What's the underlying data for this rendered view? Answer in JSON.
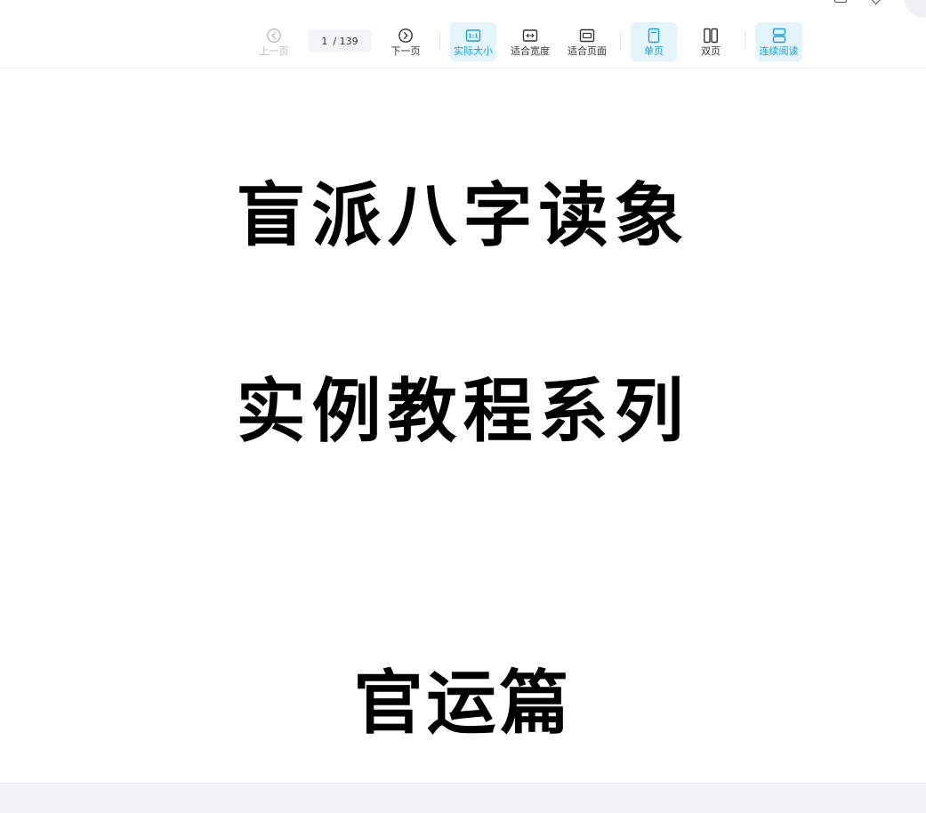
{
  "toolbar": {
    "prev_page": "上一页",
    "page_current": "1",
    "page_total": "/ 139",
    "next_page": "下一页",
    "actual_size": "实际大小",
    "actual_size_badge": "1:1",
    "fit_width": "适合宽度",
    "fit_page": "适合页面",
    "single_page": "单页",
    "double_page": "双页",
    "continuous_read": "连续阅读"
  },
  "document": {
    "title_line1": "盲派八字读象",
    "title_line2": "实例教程系列",
    "title_line3": "官运篇"
  },
  "colors": {
    "accent": "#1a9fd6",
    "active_bg": "#e4f4fb",
    "disabled": "#b8bcc4"
  }
}
